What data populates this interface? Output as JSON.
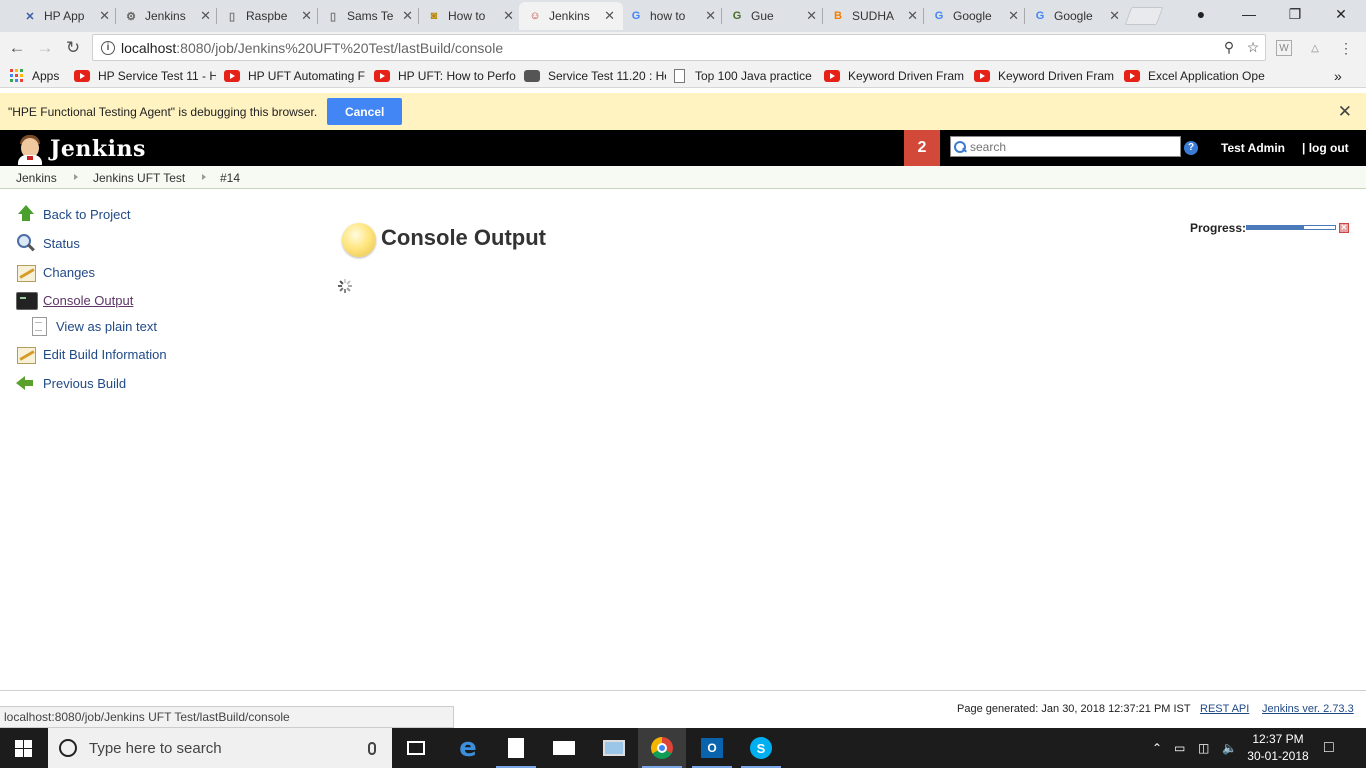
{
  "browser": {
    "tabs": [
      {
        "title": "HP App",
        "icon": "hp-tools-icon",
        "color": "#3b5ba5",
        "glyph": "✕"
      },
      {
        "title": "Jenkins",
        "icon": "settings-icon",
        "color": "#666666",
        "glyph": "⚙"
      },
      {
        "title": "Raspbe",
        "icon": "page-icon",
        "color": "#777777",
        "glyph": "▯"
      },
      {
        "title": "Sams Te",
        "icon": "page-icon",
        "color": "#777777",
        "glyph": "▯"
      },
      {
        "title": "How to",
        "icon": "site-icon",
        "color": "#b8860b",
        "glyph": "◙"
      },
      {
        "title": "Jenkins",
        "icon": "jenkins-icon",
        "color": "#c0392b",
        "glyph": "☺"
      },
      {
        "title": "how to",
        "icon": "google-icon",
        "color": "#4285f4",
        "glyph": "G"
      },
      {
        "title": "Gue",
        "icon": "gue-icon",
        "color": "#4a6b2a",
        "glyph": "G"
      },
      {
        "title": "SUDHA",
        "icon": "blogger-icon",
        "color": "#f57d00",
        "glyph": "B"
      },
      {
        "title": "Google",
        "icon": "google-icon",
        "color": "#4285f4",
        "glyph": "G"
      },
      {
        "title": "Google",
        "icon": "google-icon",
        "color": "#4285f4",
        "glyph": "G"
      }
    ],
    "active_tab_index": 5,
    "url_host": "localhost",
    "url_rest": ":8080/job/Jenkins%20UFT%20Test/lastBuild/console",
    "bookmarks": {
      "apps_label": "Apps",
      "items": [
        {
          "label": "HP Service Test 11 - H",
          "icon": "youtube-icon"
        },
        {
          "label": "HP UFT Automating F",
          "icon": "youtube-icon"
        },
        {
          "label": "HP UFT: How to Perfo",
          "icon": "youtube-icon"
        },
        {
          "label": "Service Test 11.20 : He",
          "icon": "site-icon"
        },
        {
          "label": "Top 100 Java practice",
          "icon": "page-icon"
        },
        {
          "label": "Keyword Driven Fram",
          "icon": "youtube-icon"
        },
        {
          "label": "Keyword Driven Fram",
          "icon": "youtube-icon"
        },
        {
          "label": "Excel Application Ope",
          "icon": "youtube-icon"
        }
      ],
      "overflow": "»"
    },
    "infobar": {
      "message": "\"HPE Functional Testing Agent\" is debugging this browser.",
      "cancel_label": "Cancel"
    },
    "status_url": "localhost:8080/job/Jenkins UFT Test/lastBuild/console"
  },
  "jenkins": {
    "logo_text": "Jenkins",
    "notification_count": "2",
    "search_placeholder": "search",
    "user_name": "Test Admin",
    "logout_label": "| log out",
    "breadcrumb": [
      "Jenkins",
      "Jenkins UFT Test",
      "#14"
    ],
    "sidebar": [
      {
        "label": "Back to Project",
        "icon": "arrow-up-icon"
      },
      {
        "label": "Status",
        "icon": "magnifier-icon"
      },
      {
        "label": "Changes",
        "icon": "notepad-icon"
      },
      {
        "label": "Console Output",
        "icon": "terminal-icon"
      },
      {
        "label": "View as plain text",
        "icon": "document-icon"
      },
      {
        "label": "Edit Build Information",
        "icon": "notepad-icon"
      },
      {
        "label": "Previous Build",
        "icon": "arrow-left-icon"
      }
    ],
    "page_title": "Console Output",
    "progress_label": "Progress:",
    "progress_fraction": 0.65,
    "footer": {
      "generated": "Page generated: Jan 30, 2018 12:37:21 PM IST",
      "rest_api": "REST API",
      "version": "Jenkins ver. 2.73.3"
    }
  },
  "taskbar": {
    "search_placeholder": "Type here to search",
    "time": "12:37 PM",
    "date": "30-01-2018"
  }
}
